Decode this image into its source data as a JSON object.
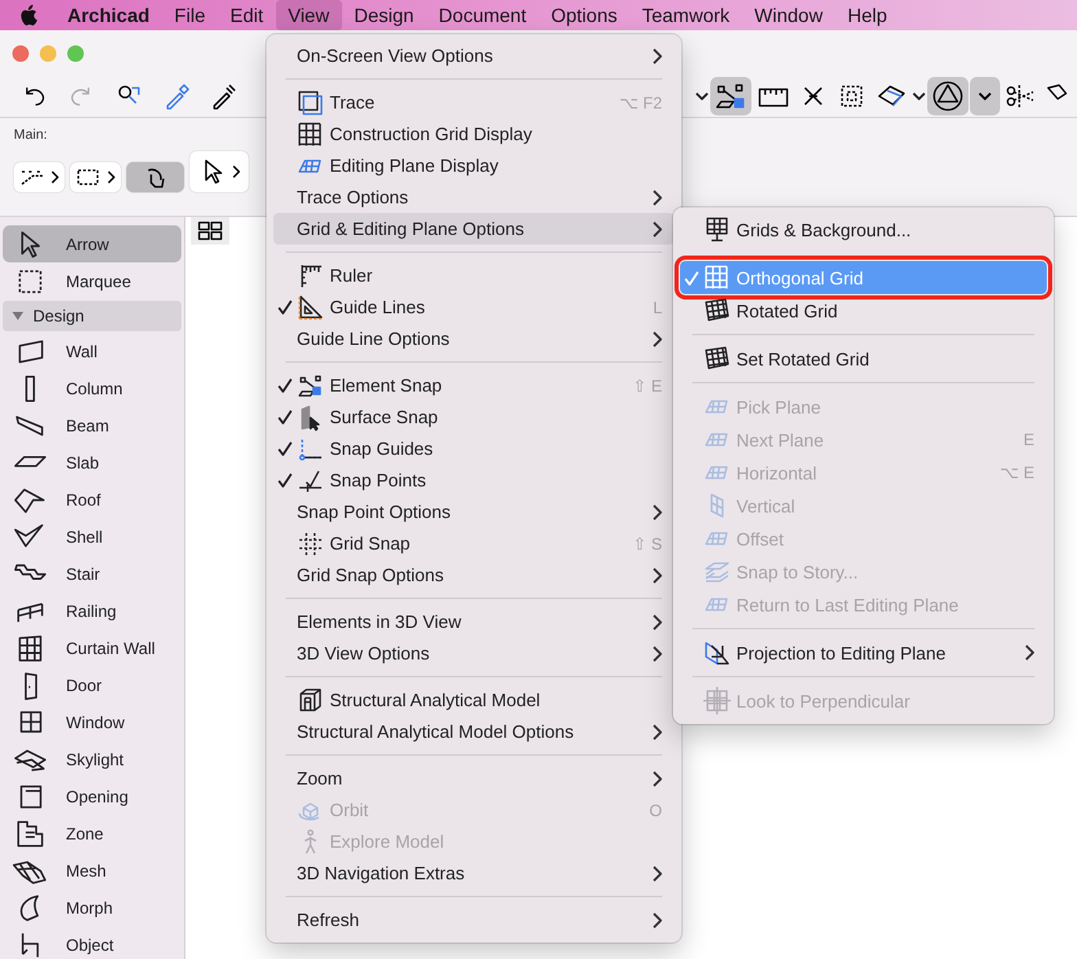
{
  "menubar": {
    "items": [
      {
        "label": "Archicad",
        "selected": false,
        "kind": "app"
      },
      {
        "label": "File",
        "selected": false,
        "kind": "menu"
      },
      {
        "label": "Edit",
        "selected": false,
        "kind": "menu"
      },
      {
        "label": "View",
        "selected": true,
        "kind": "menu"
      },
      {
        "label": "Design",
        "selected": false,
        "kind": "menu"
      },
      {
        "label": "Document",
        "selected": false,
        "kind": "menu"
      },
      {
        "label": "Options",
        "selected": false,
        "kind": "menu"
      },
      {
        "label": "Teamwork",
        "selected": false,
        "kind": "menu"
      },
      {
        "label": "Window",
        "selected": false,
        "kind": "menu"
      },
      {
        "label": "Help",
        "selected": false,
        "kind": "menu"
      }
    ]
  },
  "toolbar": {
    "main_label": "Main:"
  },
  "toolbox": {
    "items": [
      {
        "kind": "tool",
        "label": "Arrow",
        "selected": true
      },
      {
        "kind": "tool",
        "label": "Marquee",
        "selected": false
      },
      {
        "kind": "header",
        "label": "Design",
        "expanded": true
      },
      {
        "kind": "tool",
        "label": "Wall",
        "selected": false
      },
      {
        "kind": "tool",
        "label": "Column",
        "selected": false
      },
      {
        "kind": "tool",
        "label": "Beam",
        "selected": false
      },
      {
        "kind": "tool",
        "label": "Slab",
        "selected": false
      },
      {
        "kind": "tool",
        "label": "Roof",
        "selected": false
      },
      {
        "kind": "tool",
        "label": "Shell",
        "selected": false
      },
      {
        "kind": "tool",
        "label": "Stair",
        "selected": false
      },
      {
        "kind": "tool",
        "label": "Railing",
        "selected": false
      },
      {
        "kind": "tool",
        "label": "Curtain Wall",
        "selected": false
      },
      {
        "kind": "tool",
        "label": "Door",
        "selected": false
      },
      {
        "kind": "tool",
        "label": "Window",
        "selected": false
      },
      {
        "kind": "tool",
        "label": "Skylight",
        "selected": false
      },
      {
        "kind": "tool",
        "label": "Opening",
        "selected": false
      },
      {
        "kind": "tool",
        "label": "Zone",
        "selected": false
      },
      {
        "kind": "tool",
        "label": "Mesh",
        "selected": false
      },
      {
        "kind": "tool",
        "label": "Morph",
        "selected": false
      },
      {
        "kind": "tool",
        "label": "Object",
        "selected": false
      }
    ]
  },
  "view_menu": {
    "items": [
      {
        "kind": "submenu",
        "label": "On-Screen View Options",
        "checked": false,
        "disabled": false,
        "selected": false
      },
      {
        "kind": "separator"
      },
      {
        "kind": "command",
        "label": "Trace",
        "shortcut": "⌥ F2",
        "checked": false,
        "disabled": false,
        "selected": false
      },
      {
        "kind": "command",
        "label": "Construction Grid Display",
        "checked": false,
        "disabled": false,
        "selected": false
      },
      {
        "kind": "command",
        "label": "Editing Plane Display",
        "checked": false,
        "disabled": false,
        "selected": false
      },
      {
        "kind": "submenu",
        "label": "Trace Options",
        "checked": false,
        "disabled": false,
        "selected": false
      },
      {
        "kind": "submenu",
        "label": "Grid & Editing Plane Options",
        "checked": false,
        "disabled": false,
        "selected": true
      },
      {
        "kind": "separator"
      },
      {
        "kind": "command",
        "label": "Ruler",
        "checked": false,
        "disabled": false,
        "selected": false
      },
      {
        "kind": "command",
        "label": "Guide Lines",
        "shortcut": "L",
        "checked": true,
        "disabled": false,
        "selected": false
      },
      {
        "kind": "submenu",
        "label": "Guide Line Options",
        "checked": false,
        "disabled": false,
        "selected": false
      },
      {
        "kind": "separator"
      },
      {
        "kind": "command",
        "label": "Element Snap",
        "shortcut": "⇧ E",
        "checked": true,
        "disabled": false,
        "selected": false
      },
      {
        "kind": "command",
        "label": "Surface Snap",
        "checked": true,
        "disabled": false,
        "selected": false
      },
      {
        "kind": "command",
        "label": "Snap Guides",
        "checked": true,
        "disabled": false,
        "selected": false
      },
      {
        "kind": "command",
        "label": "Snap Points",
        "checked": true,
        "disabled": false,
        "selected": false
      },
      {
        "kind": "submenu",
        "label": "Snap Point Options",
        "checked": false,
        "disabled": false,
        "selected": false
      },
      {
        "kind": "command",
        "label": "Grid Snap",
        "shortcut": "⇧ S",
        "checked": false,
        "disabled": false,
        "selected": false
      },
      {
        "kind": "submenu",
        "label": "Grid Snap Options",
        "checked": false,
        "disabled": false,
        "selected": false
      },
      {
        "kind": "separator"
      },
      {
        "kind": "submenu",
        "label": "Elements in 3D View",
        "checked": false,
        "disabled": false,
        "selected": false
      },
      {
        "kind": "submenu",
        "label": "3D View Options",
        "checked": false,
        "disabled": false,
        "selected": false
      },
      {
        "kind": "separator"
      },
      {
        "kind": "command",
        "label": "Structural Analytical Model",
        "checked": false,
        "disabled": false,
        "selected": false
      },
      {
        "kind": "submenu",
        "label": "Structural Analytical Model Options",
        "checked": false,
        "disabled": false,
        "selected": false
      },
      {
        "kind": "separator"
      },
      {
        "kind": "submenu",
        "label": "Zoom",
        "checked": false,
        "disabled": false,
        "selected": false
      },
      {
        "kind": "command",
        "label": "Orbit",
        "shortcut": "O",
        "checked": false,
        "disabled": true,
        "selected": false
      },
      {
        "kind": "command",
        "label": "Explore Model",
        "checked": false,
        "disabled": true,
        "selected": false
      },
      {
        "kind": "submenu",
        "label": "3D Navigation Extras",
        "checked": false,
        "disabled": false,
        "selected": false
      },
      {
        "kind": "separator"
      },
      {
        "kind": "submenu",
        "label": "Refresh",
        "checked": false,
        "disabled": false,
        "selected": false
      }
    ]
  },
  "grid_submenu": {
    "items": [
      {
        "kind": "command",
        "label": "Grids & Background...",
        "checked": false,
        "disabled": false,
        "selected": false,
        "annotated": false
      },
      {
        "kind": "command",
        "label": "Orthogonal Grid",
        "checked": true,
        "disabled": false,
        "selected": true,
        "annotated": true
      },
      {
        "kind": "command",
        "label": "Rotated Grid",
        "checked": false,
        "disabled": false,
        "selected": false,
        "annotated": false
      },
      {
        "kind": "separator"
      },
      {
        "kind": "command",
        "label": "Set Rotated Grid",
        "checked": false,
        "disabled": false,
        "selected": false,
        "annotated": false
      },
      {
        "kind": "separator"
      },
      {
        "kind": "command",
        "label": "Pick Plane",
        "checked": false,
        "disabled": true,
        "selected": false,
        "annotated": false
      },
      {
        "kind": "command",
        "label": "Next Plane",
        "shortcut": "E",
        "checked": false,
        "disabled": true,
        "selected": false,
        "annotated": false
      },
      {
        "kind": "command",
        "label": "Horizontal",
        "shortcut": "⌥ E",
        "checked": false,
        "disabled": true,
        "selected": false,
        "annotated": false
      },
      {
        "kind": "command",
        "label": "Vertical",
        "checked": false,
        "disabled": true,
        "selected": false,
        "annotated": false
      },
      {
        "kind": "command",
        "label": "Offset",
        "checked": false,
        "disabled": true,
        "selected": false,
        "annotated": false
      },
      {
        "kind": "command",
        "label": "Snap to Story...",
        "checked": false,
        "disabled": true,
        "selected": false,
        "annotated": false
      },
      {
        "kind": "command",
        "label": "Return to Last Editing Plane",
        "checked": false,
        "disabled": true,
        "selected": false,
        "annotated": false
      },
      {
        "kind": "separator"
      },
      {
        "kind": "submenu",
        "label": "Projection to Editing Plane",
        "checked": false,
        "disabled": false,
        "selected": false,
        "annotated": false
      },
      {
        "kind": "separator"
      },
      {
        "kind": "command",
        "label": "Look to Perpendicular",
        "checked": false,
        "disabled": true,
        "selected": false,
        "annotated": false
      }
    ]
  }
}
